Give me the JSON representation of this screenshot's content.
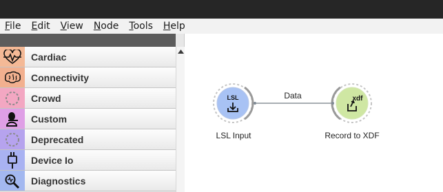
{
  "menu": {
    "items": [
      {
        "mnemonic": "F",
        "rest": "ile"
      },
      {
        "mnemonic": "E",
        "rest": "dit"
      },
      {
        "mnemonic": "V",
        "rest": "iew"
      },
      {
        "mnemonic": "N",
        "rest": "ode"
      },
      {
        "mnemonic": "T",
        "rest": "ools"
      },
      {
        "mnemonic": "H",
        "rest": "elp"
      }
    ]
  },
  "sidebar": {
    "categories": [
      {
        "label": "Cardiac",
        "icon": "heartbeat-icon",
        "color": "#f4b996"
      },
      {
        "label": "Connectivity",
        "icon": "brain-icon",
        "color": "#f2b08f"
      },
      {
        "label": "Crowd",
        "icon": "ring-icon",
        "color": "#f3a7c2"
      },
      {
        "label": "Custom",
        "icon": "user-icon",
        "color": "#df9fe6"
      },
      {
        "label": "Deprecated",
        "icon": "ring-icon",
        "color": "#b6a3ee"
      },
      {
        "label": "Device Io",
        "icon": "plug-icon",
        "color": "#a9b2f2"
      },
      {
        "label": "Diagnostics",
        "icon": "magnifier-icon",
        "color": "#a3b8f0"
      }
    ]
  },
  "canvas": {
    "link_label": "Data",
    "nodes": [
      {
        "name": "LSL Input",
        "glyph": "LSL",
        "color": "#a8c2f4"
      },
      {
        "name": "Record to XDF",
        "glyph": "xdf",
        "color": "#cfe7a3"
      }
    ]
  }
}
